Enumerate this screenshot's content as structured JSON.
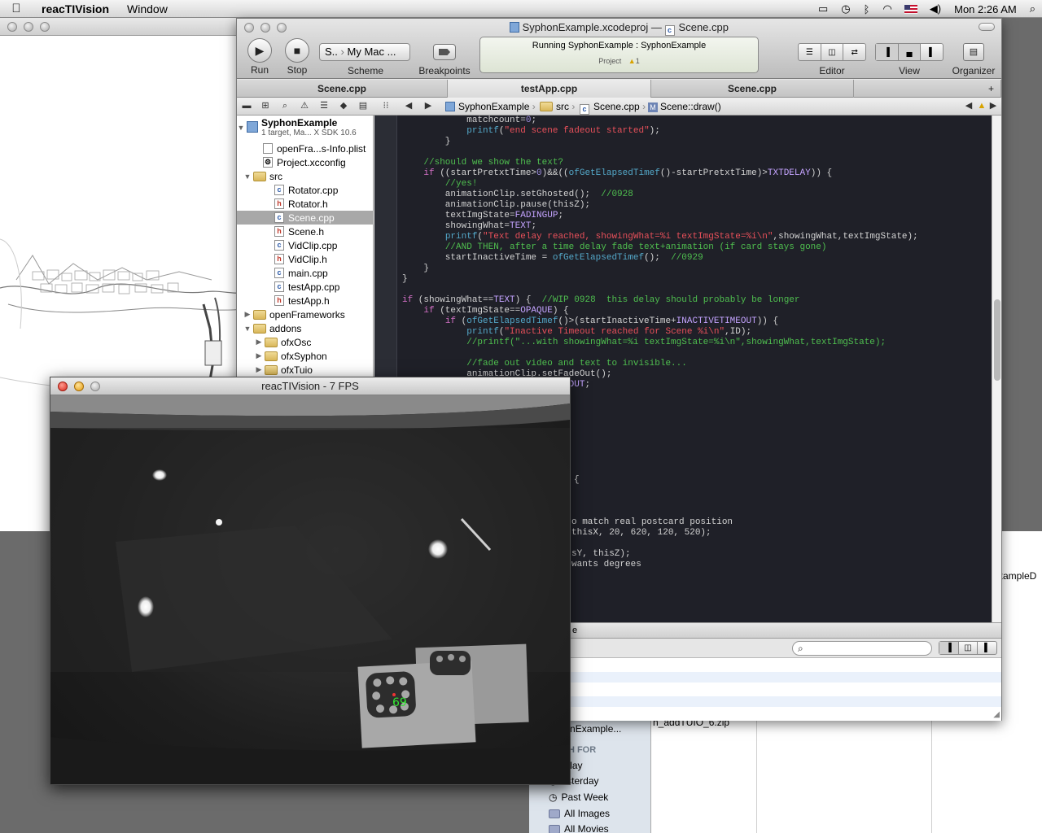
{
  "menubar": {
    "app_name": "reacTIVision",
    "menus": [
      "Window"
    ],
    "clock": "Mon 2:26 AM",
    "status_icons": [
      "display-icon",
      "time-machine-icon",
      "bluetooth-icon",
      "wifi-icon",
      "us-flag-icon",
      "volume-icon"
    ]
  },
  "xcode": {
    "title_project": "SyphonExample.xcodeproj",
    "title_separator": "—",
    "title_file": "Scene.cpp",
    "toolbar": {
      "run_label": "Run",
      "stop_label": "Stop",
      "scheme_target": "S..",
      "scheme_device": "My Mac ...",
      "scheme_label": "Scheme",
      "breakpoints_label": "Breakpoints",
      "editor_label": "Editor",
      "view_label": "View",
      "organizer_label": "Organizer"
    },
    "activity": {
      "status": "Running SyphonExample : SyphonExample",
      "project_label": "Project",
      "warning_count": "1"
    },
    "tabs": [
      "Scene.cpp",
      "testApp.cpp",
      "Scene.cpp"
    ],
    "jumpbar": [
      "SyphonExample",
      "src",
      "Scene.cpp",
      "Scene::draw()"
    ],
    "navigator": {
      "project_name": "SyphonExample",
      "project_sub": "1 target, Ma... X SDK 10.6",
      "items": [
        {
          "label": "openFra...s-Info.plist",
          "kind": "plist"
        },
        {
          "label": "Project.xcconfig",
          "kind": "config"
        },
        {
          "label": "src",
          "kind": "folder"
        },
        {
          "label": "Rotator.cpp",
          "kind": "cpp"
        },
        {
          "label": "Rotator.h",
          "kind": "h"
        },
        {
          "label": "Scene.cpp",
          "kind": "cpp",
          "selected": true
        },
        {
          "label": "Scene.h",
          "kind": "h"
        },
        {
          "label": "VidClip.cpp",
          "kind": "cpp"
        },
        {
          "label": "VidClip.h",
          "kind": "h"
        },
        {
          "label": "main.cpp",
          "kind": "cpp"
        },
        {
          "label": "testApp.cpp",
          "kind": "cpp"
        },
        {
          "label": "testApp.h",
          "kind": "h"
        },
        {
          "label": "openFrameworks",
          "kind": "folder"
        },
        {
          "label": "addons",
          "kind": "folder"
        },
        {
          "label": "ofxOsc",
          "kind": "folder"
        },
        {
          "label": "ofxSyphon",
          "kind": "folder"
        },
        {
          "label": "ofxTuio",
          "kind": "folder"
        }
      ]
    },
    "code_lines": [
      "            matchcount=0;",
      "            printf(\"end scene fadeout started\");",
      "        }",
      "",
      "    //should we show the text?",
      "    if ((startPretxtTime>0)&&((ofGetElapsedTimef()-startPretxtTime)>TXTDELAY)) {",
      "        //yes!",
      "        animationClip.setGhosted();  //0928",
      "        animationClip.pause(thisZ);",
      "        textImgState=FADINGUP;",
      "        showingWhat=TEXT;",
      "        printf(\"Text delay reached, showingWhat=%i textImgState=%i\\n\",showingWhat,textImgState);",
      "        //AND THEN, after a time delay fade text+animation (if card stays gone)",
      "        startInactiveTime = ofGetElapsedTimef();  //0929",
      "    }",
      "}",
      "",
      "if (showingWhat==TEXT) {  //WIP 0928  this delay should probably be longer",
      "    if (textImgState==OPAQUE) {",
      "        if (ofGetElapsedTimef()>(startInactiveTime+INACTIVETIMEOUT)) {",
      "            printf(\"Inactive Timeout reached for Scene %i\\n\",ID);",
      "            //printf(\"...with showingWhat=%i textImgState=%i\\n\",showingWhat,textImgState);",
      "",
      "            //fade out video and text to invisible...",
      "            animationClip.setFadeOut();",
      "            textImgState=FADINGOUT;"
    ],
    "code_fragments": [
      {
        "text": "{",
        "cls": ""
      },
      {
        "text": "o match real postcard position",
        "cls": "cm"
      },
      {
        "text": "thisX, 20, 620, 120, 520);",
        "cls": ""
      },
      {
        "text": "sY, thisZ);",
        "cls": ""
      },
      {
        "text": "wants degrees",
        "cls": "cm"
      }
    ],
    "debug_fragment": "e"
  },
  "reactivision": {
    "title": "reacTIVision - 7 FPS",
    "fiducial_id": "69"
  },
  "finder": {
    "search_for_label": "CH FOR",
    "sidebar_items": [
      "oday",
      "esterday",
      "Past Week",
      "All Images",
      "All Movies"
    ],
    "sidebar_top_item": "yphonExample...",
    "file_fragment_1": "n_addTUIO_6.zip",
    "file_fragment_2": "xampleD"
  }
}
